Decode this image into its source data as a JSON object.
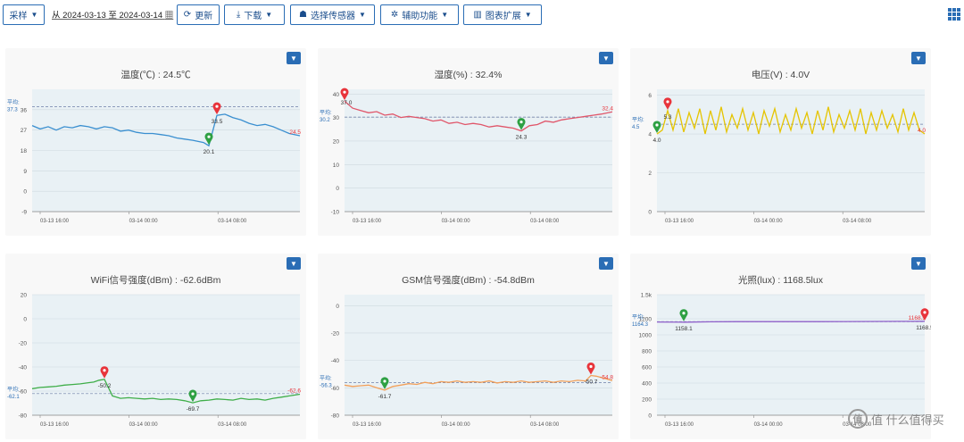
{
  "toolbar": {
    "sample_label": "采样",
    "date_range": "从 2024-03-13 至 2024-03-14",
    "refresh_label": "更新",
    "download_label": "下载",
    "select_sensor_label": "选择传感器",
    "assist_label": "辅助功能",
    "chart_ext_label": "图表扩展"
  },
  "watermark": "值 什么值得买",
  "x_ticks": [
    "03-13 16:00",
    "03-14 00:00",
    "03-14 08:00"
  ],
  "avg_prefix": "平均:",
  "colors": {
    "accent": "#2a6db5",
    "max_marker": "#e8343b",
    "min_marker": "#2ea043"
  },
  "chart_data": [
    {
      "type": "line",
      "title": "温度(℃) : 24.5℃",
      "color": "#3a8fd0",
      "ylim": [
        -9,
        45
      ],
      "yticks": [
        -9,
        0,
        9,
        18,
        27,
        36
      ],
      "avg": 37.3,
      "avg_label": "37.3",
      "series": [
        {
          "x": [
            0,
            0.03,
            0.06,
            0.09,
            0.12,
            0.15,
            0.18,
            0.21,
            0.24,
            0.27,
            0.3,
            0.33,
            0.36,
            0.39,
            0.42,
            0.45,
            0.48,
            0.51,
            0.54,
            0.57,
            0.6,
            0.62,
            0.64,
            0.66,
            0.69,
            0.72,
            0.75,
            0.78,
            0.81,
            0.84,
            0.87,
            0.9,
            0.93,
            0.96,
            1.0
          ],
          "values": [
            29,
            27.5,
            28.5,
            27,
            28.5,
            28,
            29,
            28.5,
            27.5,
            28.5,
            28,
            26.5,
            27,
            26,
            25.5,
            25.5,
            25,
            24.5,
            23.5,
            23,
            22.5,
            22,
            21.5,
            20.1,
            33.5,
            34,
            32.5,
            31.5,
            30,
            29,
            29.5,
            28.5,
            27,
            25.5,
            24.5
          ]
        }
      ],
      "markers": [
        {
          "kind": "min",
          "xi": 23,
          "value": "20.1",
          "label_pos": "below"
        },
        {
          "kind": "max",
          "xi": 24,
          "value": "33.5",
          "label_pos": "below"
        }
      ],
      "last_label": "24.5"
    },
    {
      "type": "line",
      "title": "湿度(%) : 32.4%",
      "color": "#e0566a",
      "ylim": [
        -10,
        42
      ],
      "yticks": [
        -10,
        0,
        10,
        20,
        30,
        40
      ],
      "avg": 30.2,
      "avg_label": "30.2",
      "series": [
        {
          "x": [
            0,
            0.03,
            0.06,
            0.09,
            0.12,
            0.15,
            0.18,
            0.21,
            0.24,
            0.27,
            0.3,
            0.33,
            0.36,
            0.39,
            0.42,
            0.45,
            0.48,
            0.51,
            0.54,
            0.57,
            0.6,
            0.63,
            0.66,
            0.69,
            0.72,
            0.75,
            0.78,
            0.81,
            0.84,
            0.87,
            0.9,
            0.93,
            0.96,
            1.0
          ],
          "values": [
            37,
            34,
            33,
            32,
            32.5,
            31,
            31.5,
            30,
            30.5,
            30,
            29.5,
            28.5,
            29,
            27.5,
            28,
            27,
            27.5,
            27,
            26,
            26.5,
            26,
            25.5,
            24.3,
            26.5,
            27,
            28.5,
            28,
            29,
            29.5,
            30,
            30.5,
            31,
            31.5,
            32.4
          ]
        }
      ],
      "markers": [
        {
          "kind": "max",
          "xi": 0,
          "value": "37.0",
          "label_pos": "right"
        },
        {
          "kind": "min",
          "xi": 22,
          "value": "24.3",
          "label_pos": "below"
        }
      ],
      "last_label": "32.4"
    },
    {
      "type": "line",
      "title": "电压(V) : 4.0V",
      "color": "#e5c400",
      "ylim": [
        0,
        6.3
      ],
      "yticks": [
        0,
        2,
        4,
        6
      ],
      "avg": 4.5,
      "avg_label": "4.5",
      "series": [
        {
          "x": [
            0,
            0.02,
            0.04,
            0.06,
            0.08,
            0.1,
            0.12,
            0.14,
            0.16,
            0.18,
            0.2,
            0.22,
            0.24,
            0.26,
            0.28,
            0.3,
            0.32,
            0.34,
            0.36,
            0.38,
            0.4,
            0.42,
            0.44,
            0.46,
            0.48,
            0.5,
            0.52,
            0.54,
            0.56,
            0.58,
            0.6,
            0.62,
            0.64,
            0.66,
            0.68,
            0.7,
            0.72,
            0.74,
            0.76,
            0.78,
            0.8,
            0.82,
            0.84,
            0.86,
            0.88,
            0.9,
            0.92,
            0.94,
            0.96,
            0.98,
            1.0
          ],
          "values": [
            4.0,
            4.2,
            5.2,
            4.2,
            5.3,
            4.1,
            5.1,
            4.3,
            5.3,
            4.0,
            5.2,
            4.2,
            5.4,
            4.1,
            5.0,
            4.3,
            5.3,
            4.2,
            5.1,
            4.0,
            5.2,
            4.4,
            5.3,
            4.1,
            5.0,
            4.2,
            5.3,
            4.3,
            5.1,
            4.0,
            5.2,
            4.2,
            5.4,
            4.1,
            5.0,
            4.3,
            5.2,
            4.2,
            5.3,
            4.0,
            5.1,
            4.2,
            5.2,
            4.3,
            5.0,
            4.1,
            5.3,
            4.2,
            5.1,
            4.2,
            4.0
          ]
        }
      ],
      "markers": [
        {
          "kind": "min",
          "xi": 0,
          "value": "4.0",
          "label_pos": "below"
        },
        {
          "kind": "max",
          "xi": 2,
          "value": "5.3",
          "label_pos": "below"
        }
      ],
      "last_label": "4.0"
    },
    {
      "type": "line",
      "title": "WiFi信号强度(dBm) : -62.6dBm",
      "color": "#3fae49",
      "ylim": [
        -80,
        20
      ],
      "yticks": [
        -80,
        -60,
        -40,
        -20,
        0,
        20
      ],
      "avg": -62.1,
      "avg_label": "-62.1",
      "series": [
        {
          "x": [
            0,
            0.03,
            0.06,
            0.09,
            0.12,
            0.15,
            0.18,
            0.21,
            0.23,
            0.25,
            0.27,
            0.3,
            0.33,
            0.36,
            0.39,
            0.42,
            0.45,
            0.48,
            0.51,
            0.54,
            0.57,
            0.6,
            0.63,
            0.66,
            0.69,
            0.72,
            0.75,
            0.78,
            0.81,
            0.84,
            0.87,
            0.9,
            0.93,
            0.96,
            1.0
          ],
          "values": [
            -58,
            -57,
            -56.5,
            -56,
            -55,
            -54.5,
            -54,
            -53,
            -52.5,
            -51,
            -50.2,
            -64,
            -66,
            -65.5,
            -66,
            -66.5,
            -66,
            -67,
            -66.5,
            -67,
            -68,
            -69.7,
            -68,
            -67.5,
            -66.5,
            -67,
            -67.5,
            -66,
            -67,
            -66.5,
            -67.5,
            -66,
            -65,
            -64,
            -62.6
          ]
        }
      ],
      "markers": [
        {
          "kind": "max",
          "xi": 10,
          "value": "-50.2",
          "label_pos": "below"
        },
        {
          "kind": "min",
          "xi": 21,
          "value": "-69.7",
          "label_pos": "below"
        }
      ],
      "last_label": "-62.6"
    },
    {
      "type": "line",
      "title": "GSM信号强度(dBm) : -54.8dBm",
      "color": "#f2a05a",
      "ylim": [
        -80,
        8
      ],
      "yticks": [
        -80,
        -60,
        -40,
        -20,
        0
      ],
      "avg": -56.3,
      "avg_label": "-56.3",
      "series": [
        {
          "x": [
            0,
            0.03,
            0.06,
            0.09,
            0.12,
            0.15,
            0.18,
            0.21,
            0.24,
            0.27,
            0.3,
            0.33,
            0.36,
            0.39,
            0.42,
            0.45,
            0.48,
            0.51,
            0.54,
            0.57,
            0.6,
            0.63,
            0.66,
            0.69,
            0.72,
            0.75,
            0.78,
            0.81,
            0.84,
            0.87,
            0.9,
            0.92,
            0.94,
            0.97,
            1.0
          ],
          "values": [
            -58,
            -59,
            -58.5,
            -58,
            -60,
            -61.7,
            -59,
            -58,
            -57,
            -57.5,
            -56,
            -57,
            -55.5,
            -56,
            -55,
            -56,
            -55.5,
            -56,
            -55,
            -56.5,
            -55.5,
            -56,
            -55,
            -56,
            -55.5,
            -55,
            -56,
            -55,
            -55.5,
            -54.5,
            -55,
            -51,
            -51.5,
            -53,
            -54.8
          ]
        }
      ],
      "markers": [
        {
          "kind": "min",
          "xi": 5,
          "value": "-61.7",
          "label_pos": "below"
        },
        {
          "kind": "max",
          "xi": 31,
          "value": "-50.7",
          "label_pos": "below"
        }
      ],
      "last_label": "-54.8"
    },
    {
      "type": "line",
      "title": "光照(lux) : 1168.5lux",
      "color": "#8e5fc9",
      "ylim": [
        0,
        1500
      ],
      "yticks": [
        0,
        200,
        400,
        600,
        800,
        1000,
        1200,
        "1.5k"
      ],
      "avg": 1164.3,
      "avg_label": "1164.3",
      "series": [
        {
          "x": [
            0,
            0.1,
            0.2,
            0.3,
            0.4,
            0.5,
            0.6,
            0.7,
            0.8,
            0.9,
            1.0
          ],
          "values": [
            1160,
            1158.1,
            1162,
            1164,
            1165,
            1164,
            1165,
            1166,
            1167,
            1168,
            1168.5
          ]
        }
      ],
      "markers": [
        {
          "kind": "min",
          "xi": 1,
          "value": "1158.1",
          "label_pos": "below"
        },
        {
          "kind": "max",
          "xi": 10,
          "value": "1168.5",
          "label_pos": "below"
        }
      ],
      "last_label": "1168.5"
    }
  ]
}
